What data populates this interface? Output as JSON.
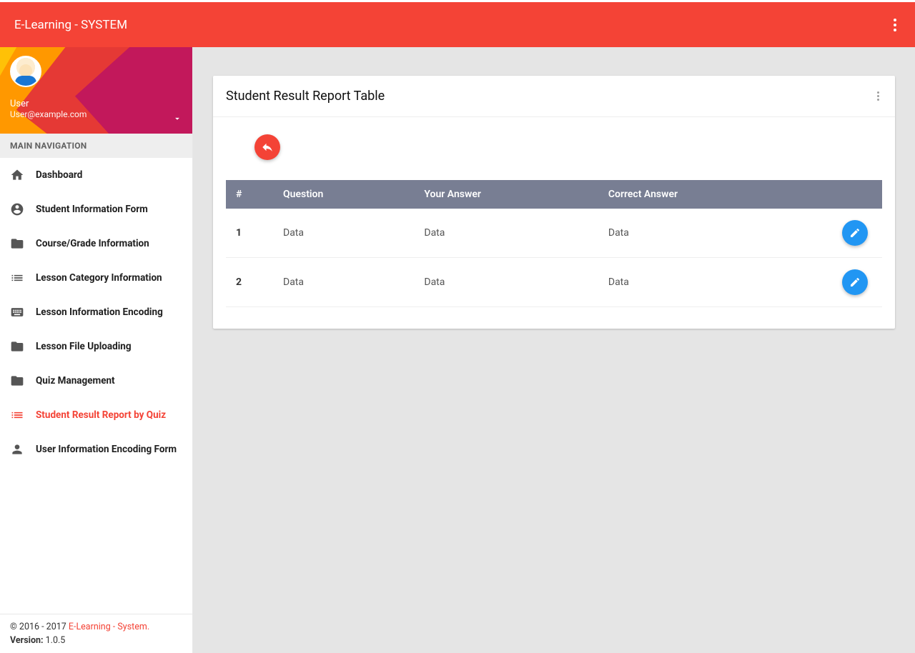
{
  "header": {
    "brand": "E-Learning - SYSTEM"
  },
  "user": {
    "name": "User",
    "email": "User@example.com"
  },
  "nav": {
    "title": "MAIN NAVIGATION",
    "items": [
      {
        "label": "Dashboard",
        "icon": "home-icon",
        "active": false
      },
      {
        "label": "Student Information Form",
        "icon": "account-circle-icon",
        "active": false
      },
      {
        "label": "Course/Grade Information",
        "icon": "folder-icon",
        "active": false
      },
      {
        "label": "Lesson Category Information",
        "icon": "list-icon",
        "active": false
      },
      {
        "label": "Lesson Information Encoding",
        "icon": "keyboard-icon",
        "active": false
      },
      {
        "label": "Lesson File Uploading",
        "icon": "folder-icon",
        "active": false
      },
      {
        "label": "Quiz Management",
        "icon": "folder-icon",
        "active": false
      },
      {
        "label": "Student Result Report by Quiz",
        "icon": "list-icon",
        "active": true
      },
      {
        "label": "User Information Encoding Form",
        "icon": "person-icon",
        "active": false
      }
    ]
  },
  "card": {
    "title": "Student Result Report Table",
    "columns": [
      "#",
      "Question",
      "Your Answer",
      "Correct Answer",
      ""
    ],
    "rows": [
      {
        "n": "1",
        "question": "Data",
        "your": "Data",
        "correct": "Data"
      },
      {
        "n": "2",
        "question": "Data",
        "your": "Data",
        "correct": "Data"
      }
    ]
  },
  "footer": {
    "copyright_prefix": "© 2016 - 2017 ",
    "link_text": "E-Learning - System.",
    "version_label": "Version:",
    "version_value": " 1.0.5"
  }
}
